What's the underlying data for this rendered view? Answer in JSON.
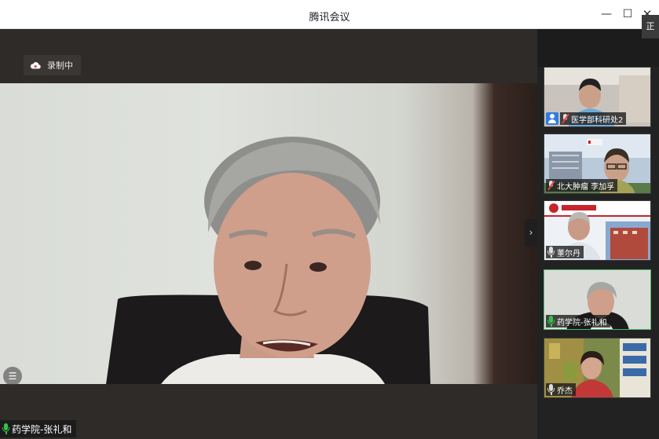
{
  "window": {
    "title": "腾讯会议",
    "minimize_glyph": "—",
    "maximize_glyph": "☐",
    "close_glyph": "✕",
    "edge_tag": "正"
  },
  "stage": {
    "recording_label": "录制中",
    "recording_icon": "cloud-icon",
    "speaker_name": "药学院-张礼和",
    "speaker_mic_state": "speaking",
    "list_toggle_glyph": "☰",
    "expand_glyph": "›"
  },
  "participants": [
    {
      "name": "医学部科研处2",
      "icon": "person-icon",
      "mic": "off",
      "active": false
    },
    {
      "name": "北大肿瘤 李加孚",
      "icon": "mic-off-icon",
      "mic": "off",
      "active": false
    },
    {
      "name": "董尔丹",
      "icon": "mic-icon",
      "mic": "on",
      "active": false
    },
    {
      "name": "药学院-张礼和",
      "icon": "mic-icon",
      "mic": "speaking",
      "active": true
    },
    {
      "name": "乔杰",
      "icon": "mic-icon",
      "mic": "on",
      "active": false
    }
  ],
  "colors": {
    "speaking": "#35c24a",
    "active_border": "#49b86a",
    "stage_bg": "#2f2b29",
    "panel_bg": "#222222"
  }
}
